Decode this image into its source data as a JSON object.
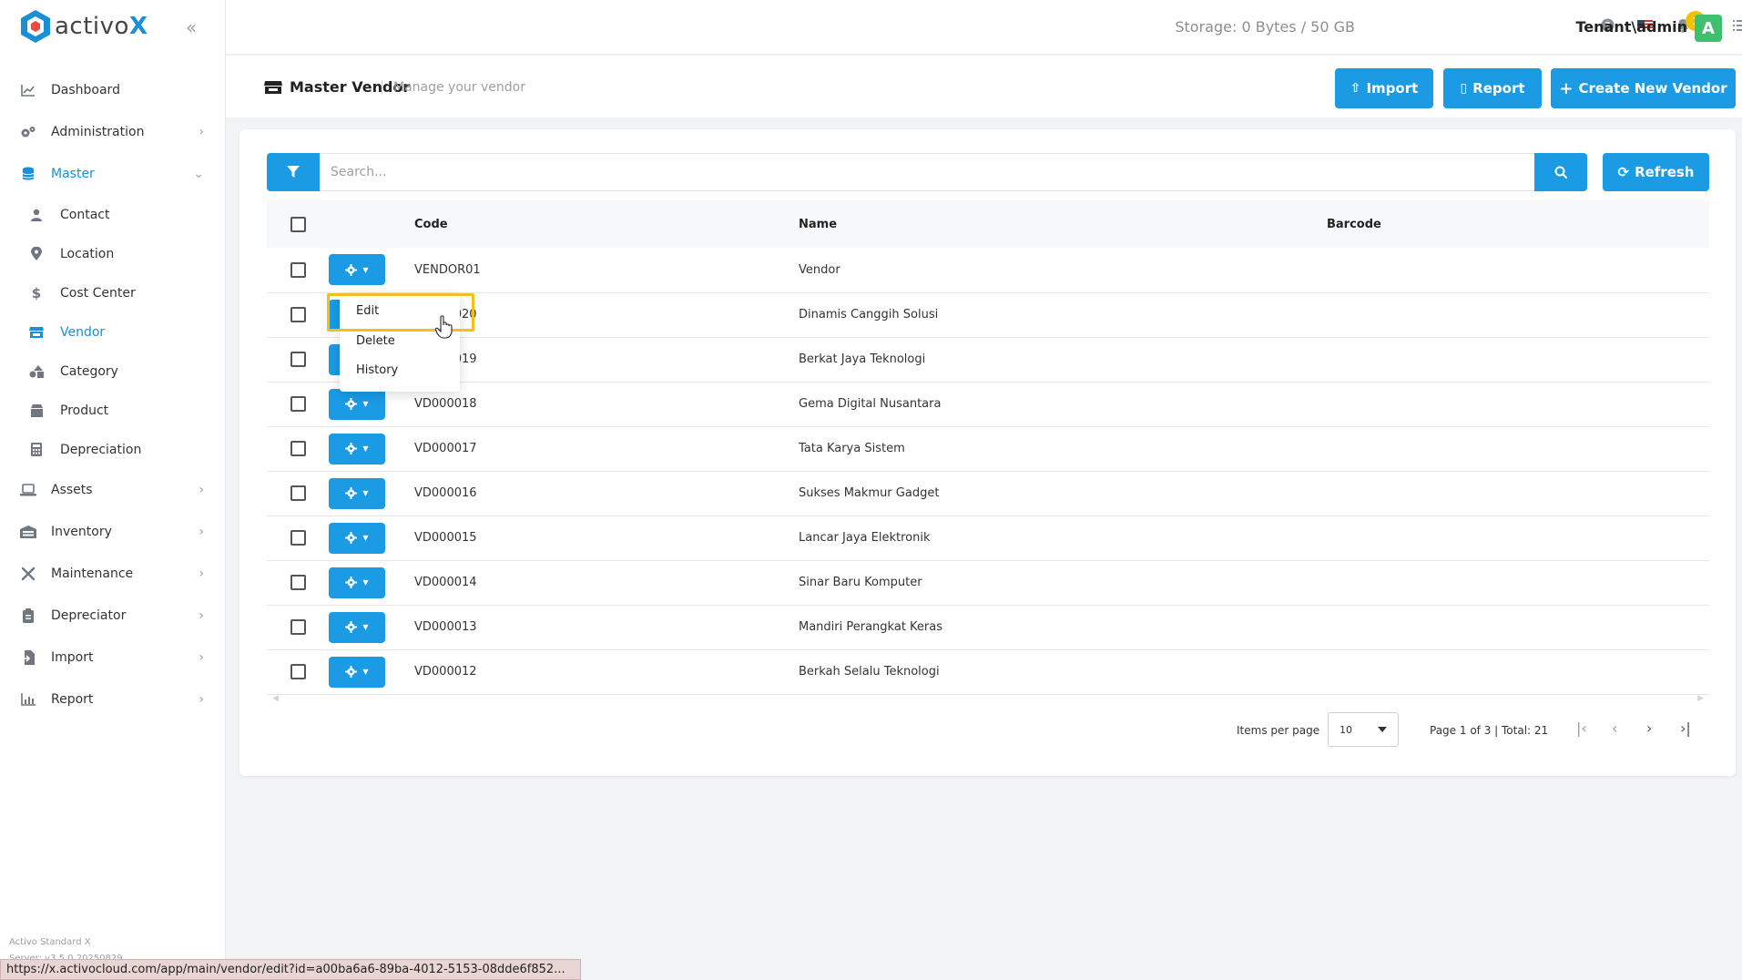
{
  "brand": {
    "logo_text": "activo",
    "logo_x": "X",
    "accent": "#1a9be4"
  },
  "sidebar": {
    "items": [
      {
        "label": "Dashboard",
        "icon": "chart-line-icon",
        "has_children": false
      },
      {
        "label": "Administration",
        "icon": "gears-icon",
        "has_children": true
      },
      {
        "label": "Master",
        "icon": "database-icon",
        "has_children": true,
        "expanded": true,
        "active": true
      },
      {
        "label": "Assets",
        "icon": "laptop-icon",
        "has_children": true
      },
      {
        "label": "Inventory",
        "icon": "warehouse-icon",
        "has_children": true
      },
      {
        "label": "Maintenance",
        "icon": "tools-icon",
        "has_children": true
      },
      {
        "label": "Depreciator",
        "icon": "clipboard-icon",
        "has_children": true
      },
      {
        "label": "Import",
        "icon": "file-import-icon",
        "has_children": true
      },
      {
        "label": "Report",
        "icon": "chart-bar-icon",
        "has_children": true
      }
    ],
    "master_children": [
      {
        "label": "Contact",
        "icon": "user-icon"
      },
      {
        "label": "Location",
        "icon": "map-pin-icon"
      },
      {
        "label": "Cost Center",
        "icon": "dollar-icon"
      },
      {
        "label": "Vendor",
        "icon": "store-icon",
        "active": true
      },
      {
        "label": "Category",
        "icon": "shapes-icon"
      },
      {
        "label": "Product",
        "icon": "box-icon"
      },
      {
        "label": "Depreciation",
        "icon": "calculator-icon"
      }
    ],
    "footer_line1": "Activo Standard X",
    "footer_line2": "Server: v3.5.0.20250829"
  },
  "topbar": {
    "storage": "Storage: 0 Bytes / 50 GB",
    "notification_count": "1",
    "user": "Tenant\\admin",
    "avatar_letter": "A"
  },
  "page": {
    "title": "Master Vendor",
    "subtitle": "Manage your vendor",
    "import_label": "Import",
    "report_label": "Report",
    "create_label": "Create New Vendor"
  },
  "toolbar": {
    "search_placeholder": "Search...",
    "refresh_label": "Refresh"
  },
  "table": {
    "headers": {
      "code": "Code",
      "name": "Name",
      "barcode": "Barcode"
    },
    "rows": [
      {
        "code": "VENDOR01",
        "name": "Vendor",
        "barcode": ""
      },
      {
        "code": "VD000020",
        "name": "Dinamis Canggih Solusi",
        "barcode": ""
      },
      {
        "code": "VD000019",
        "name": "Berkat Jaya Teknologi",
        "barcode": ""
      },
      {
        "code": "VD000018",
        "name": "Gema Digital Nusantara",
        "barcode": ""
      },
      {
        "code": "VD000017",
        "name": "Tata Karya Sistem",
        "barcode": ""
      },
      {
        "code": "VD000016",
        "name": "Sukses Makmur Gadget",
        "barcode": ""
      },
      {
        "code": "VD000015",
        "name": "Lancar Jaya Elektronik",
        "barcode": ""
      },
      {
        "code": "VD000014",
        "name": "Sinar Baru Komputer",
        "barcode": ""
      },
      {
        "code": "VD000013",
        "name": "Mandiri Perangkat Keras",
        "barcode": ""
      },
      {
        "code": "VD000012",
        "name": "Berkah Selalu Teknologi",
        "barcode": ""
      }
    ]
  },
  "context_menu": {
    "edit": "Edit",
    "delete": "Delete",
    "history": "History"
  },
  "pagination": {
    "items_per_page_label": "Items per page",
    "items_per_page": "10",
    "page_info": "Page 1 of 3 | Total: 21"
  },
  "status_bar": {
    "url": "https://x.activocloud.com/app/main/vendor/edit?id=a00ba6a6-89ba-4012-5153-08dde6f852..."
  }
}
